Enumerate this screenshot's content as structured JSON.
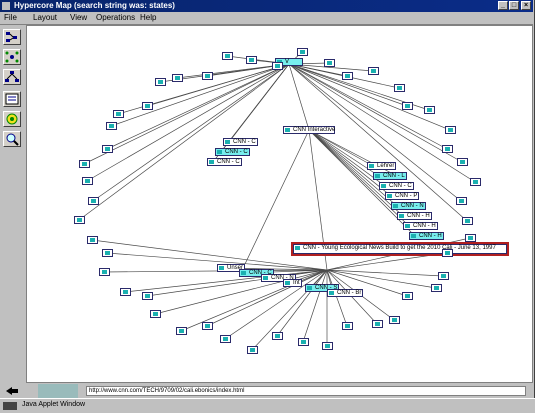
{
  "window": {
    "title": "Hypercore Map (search string was: states)"
  },
  "menu": [
    "File",
    "Layout",
    "View",
    "Operations",
    "Help"
  ],
  "toolbar_icons": [
    "hierarchy-icon",
    "network-icon",
    "tree-icon",
    "list-icon",
    "circle-view-icon",
    "zoom-icon"
  ],
  "center_nodes": {
    "main": "CNN Interactive",
    "top": "V",
    "highlight": "CNN - Young Ecological News Build to get the 2010 Cali - June 13, 1997"
  },
  "cluster_left": [
    "CNN - C",
    "CNN - C",
    "CNN - C"
  ],
  "cluster_right": [
    "Lehrer",
    "CNN - L",
    "CNN - C",
    "CNN - P",
    "CNN - N",
    "CNN - H",
    "CNN - H",
    "CNN - H"
  ],
  "cluster_bottom": [
    "Unser",
    "CNN - C",
    "CNN - N",
    "Int",
    "CNN - S",
    "CNN - Br"
  ],
  "status": {
    "url": "http://www.cnn.com/TECH/9709/02/cali.ebonics/index.html"
  },
  "taskbar": {
    "label": "Java Applet Window"
  }
}
